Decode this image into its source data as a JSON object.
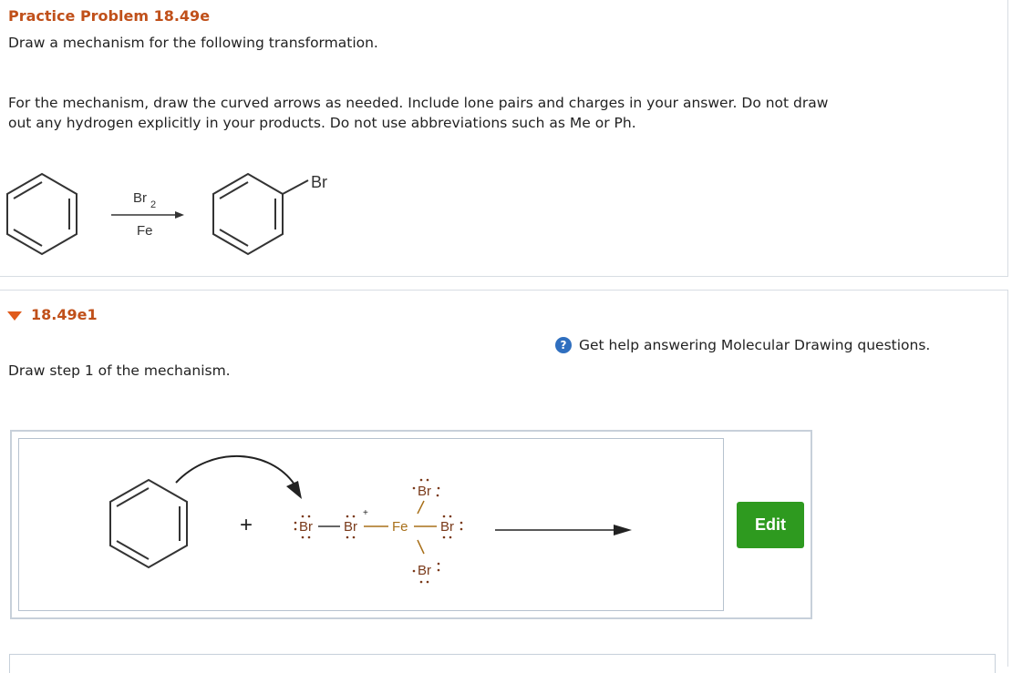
{
  "problem": {
    "title": "Practice Problem 18.49e",
    "instruction": "Draw a mechanism for the following transformation.",
    "details_line1": "For the mechanism, draw the curved arrows as needed. Include lone pairs and charges in your answer.  Do not draw",
    "details_line2": "out any hydrogen explicitly in your products. Do not use abbreviations such as Me or Ph.",
    "reaction": {
      "reagent_top": "Br",
      "reagent_top_sub": "2",
      "reagent_bottom": "Fe",
      "product_substituent": "Br"
    }
  },
  "subpart": {
    "title": "18.49e1",
    "help_text": "Get help answering Molecular Drawing questions.",
    "help_icon": "?",
    "step_text": "Draw step 1 of the mechanism.",
    "drawing": {
      "plus": "+",
      "atom_br": "Br",
      "atom_fe": "Fe",
      "charge": "+"
    },
    "edit_label": "Edit"
  },
  "colors": {
    "title": "#c0501a",
    "edit_button": "#2e9a1f",
    "help_icon": "#2f6fbf",
    "fe_color": "#a8701a",
    "br_color": "#7a3a1a"
  }
}
